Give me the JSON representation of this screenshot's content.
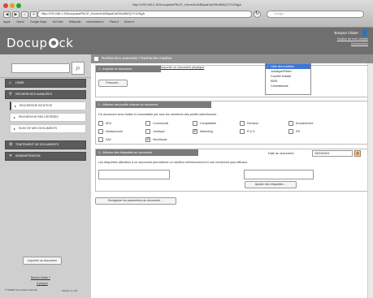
{
  "browser": {
    "window_title": "http://190.168.1.5/Docupack/PACE_Home/bJAB4paKlaiYBrz$WQ7V1ZNgA",
    "url": "http://190.168.1.5/Docupack/PACE_Home/bJAB4paKlaiYBrz$WQ7V1ZNgA",
    "search_placeholder": "Google",
    "bookmarks": [
      "Apple",
      "Yahoo!",
      "Google Maps",
      "YouTube",
      "Wikipedia",
      "Informations ▾",
      "Plans ▾",
      "Divers ▾"
    ],
    "traffic_colors": [
      "#e0443e",
      "#dea123",
      "#1aab29"
    ]
  },
  "header": {
    "logo_left": "Docup",
    "logo_right": "ck",
    "greeting": "Bonjour Olivier",
    "account_link": "Gestion de mon compte",
    "logout_link": "Déconnexion",
    "background": "#6f6f6f"
  },
  "sidebar": {
    "search_value": "",
    "menu": {
      "home": "HOME",
      "advanced_search": "RECHERCHES AVANCÉES",
      "intuitive": "RECHERCHE INTUITIVE",
      "by_criteria": "RECHERCHE PAR CRITÈRES",
      "followup": "SUIVI DE MES DOCUMENTS",
      "processing": "TRAITEMENT DE DOCUMENTS",
      "admin": "ADMINISTRATION"
    },
    "import_button": "Importer un document",
    "help_link": "Besoin d'aide ?",
    "about_link": "A propos",
    "copyright": "© ASPEX tous droits réservés",
    "version": "Version 3.1.64"
  },
  "main": {
    "tab_title": "Recherches avancées / Recherche intuitive",
    "section1": {
      "title": "1 - Importer le document",
      "physical_link": "Importer un document physique",
      "browse_button": "Parcourir...",
      "doc_types": [
        "Liste des modèles",
        "Juridique/Prêlèv",
        "Courrier entrant",
        "KBIS",
        "Commissions"
      ],
      "selected_type": "Liste des modèles"
    },
    "section2": {
      "title": "2 - Affecter des profils d'accès au document",
      "description": "Ce document sera visible et consultable par tous les membres des profils sélectionnés :",
      "profiles": [
        {
          "label": "ADV",
          "checked": false
        },
        {
          "label": "Commercial",
          "checked": false
        },
        {
          "label": "Comptabilité",
          "checked": false
        },
        {
          "label": "Direction",
          "checked": false
        },
        {
          "label": "Encadrement",
          "checked": false
        },
        {
          "label": "Infrastructure",
          "checked": false
        },
        {
          "label": "Juridique",
          "checked": false
        },
        {
          "label": "Marketing",
          "checked": true
        },
        {
          "label": "R & D",
          "checked": false
        },
        {
          "label": "RH",
          "checked": false
        },
        {
          "label": "SAV",
          "checked": false
        },
        {
          "label": "Secrétariat",
          "checked": true
        }
      ]
    },
    "section3": {
      "title": "3 - Affecter des étiquettes au document",
      "date_label": "Date du document :",
      "date_value": "15/03/2011",
      "description": "Les étiquettes affectées à ce document permettront un meilleur référencement et une recherche plus efficace.",
      "tags_value": "",
      "add_tags_button": "Ajouter des étiquettes ..."
    },
    "save_button": "Enregistrer les paramètres du document ..."
  }
}
